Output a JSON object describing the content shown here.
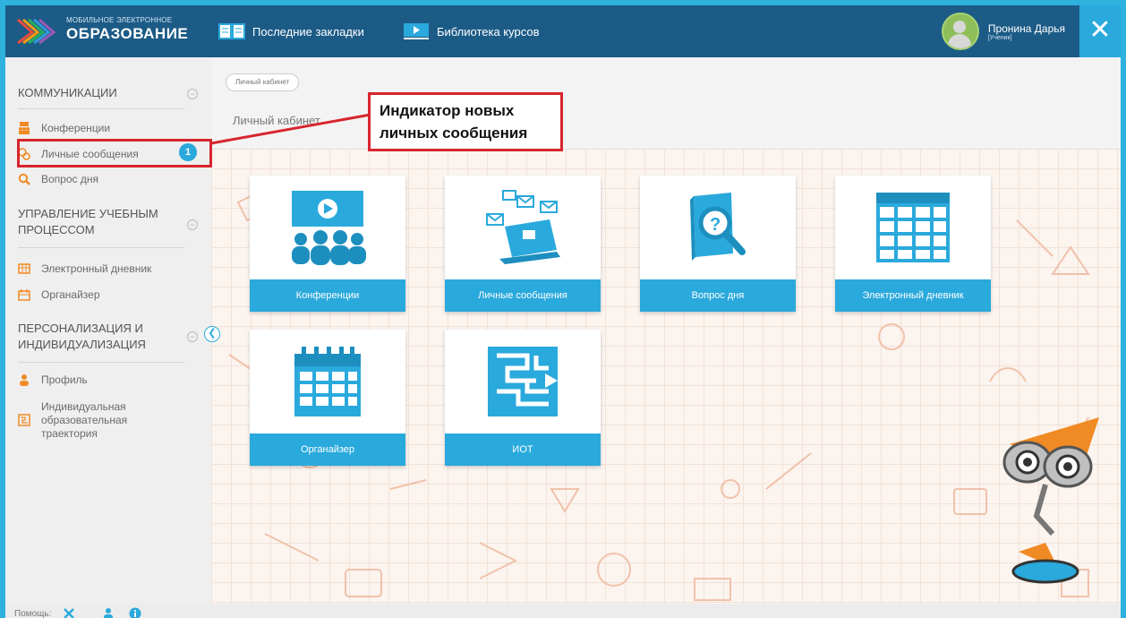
{
  "topbar": {
    "logo_small": "МОБИЛЬНОЕ ЭЛЕКТРОННОЕ",
    "logo_big": "ОБРАЗОВАНИЕ",
    "bookmarks_label": "Последние закладки",
    "library_label": "Библиотека курсов",
    "user_name": "Пронина Дарья",
    "user_role": "[Ученик]",
    "close_icon": "close-x"
  },
  "sidebar": {
    "sections": [
      {
        "title": "КОММУНИКАЦИИ"
      },
      {
        "title_line1": "УПРАВЛЕНИЕ УЧЕБНЫМ",
        "title_line2": "ПРОЦЕССОМ"
      },
      {
        "title_line1": "ПЕРСОНАЛИЗАЦИЯ И",
        "title_line2": "ИНДИВИДУАЛИЗАЦИЯ"
      }
    ],
    "items": {
      "conferences": "Конференции",
      "messages": "Личные сообщения",
      "question": "Вопрос дня",
      "diary": "Электронный дневник",
      "organizer": "Органайзер",
      "profile": "Профиль",
      "trajectory_line1": "Индивидуальная",
      "trajectory_line2": "образовательная",
      "trajectory_line3": "траектория"
    },
    "messages_badge": "1"
  },
  "content": {
    "breadcrumb": "Личный кабинет",
    "page_title": "Личный кабинет",
    "tiles": [
      {
        "label": "Конференции",
        "icon": "conference-icon"
      },
      {
        "label": "Личные сообщения",
        "icon": "messages-laptop-icon"
      },
      {
        "label": "Вопрос дня",
        "icon": "question-magnifier-icon"
      },
      {
        "label": "Электронный дневник",
        "icon": "diary-grid-icon"
      },
      {
        "label": "Органайзер",
        "icon": "calendar-icon"
      },
      {
        "label": "ИОТ",
        "icon": "maze-icon"
      }
    ]
  },
  "annotation": {
    "line1": "Индикатор новых",
    "line2": "личных сообщения"
  },
  "footer": {
    "help_label": "Помощь:"
  },
  "colors": {
    "topbar": "#1c5b86",
    "accent": "#2aa9dc",
    "highlight": "#d7252e",
    "sidebar_icon": "#f08a24"
  }
}
